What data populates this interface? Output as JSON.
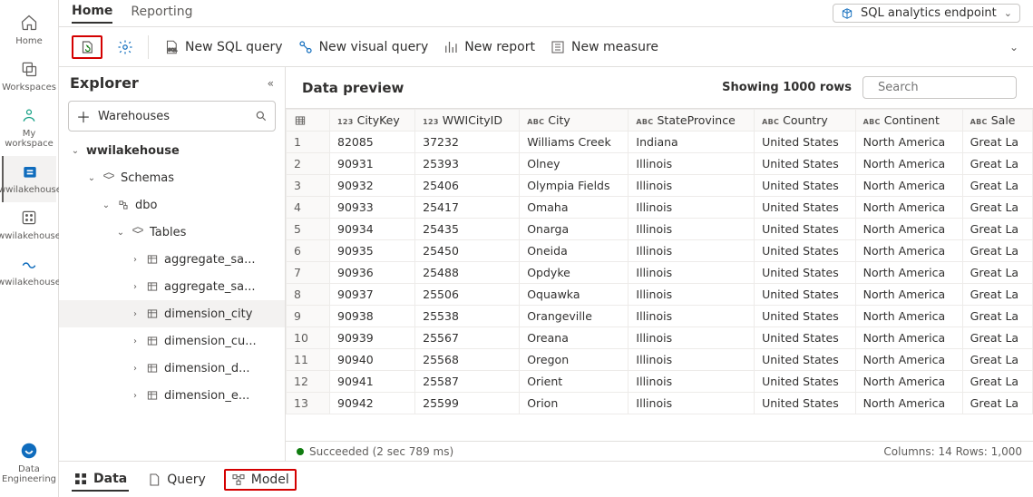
{
  "rail": {
    "home": "Home",
    "workspaces": "Workspaces",
    "my_workspace": "My workspace",
    "item1": "wwilakehouse",
    "item2": "wwilakehouse",
    "item3": "wwilakehouse",
    "data_eng": "Data Engineering"
  },
  "tabs": {
    "home": "Home",
    "reporting": "Reporting"
  },
  "endpoint": {
    "label": "SQL analytics endpoint"
  },
  "toolbar": {
    "new_sql": "New SQL query",
    "new_visual": "New visual query",
    "new_report": "New report",
    "new_measure": "New measure"
  },
  "explorer": {
    "title": "Explorer",
    "warehouses": "Warehouses",
    "lakehouse": "wwilakehouse",
    "schemas": "Schemas",
    "dbo": "dbo",
    "tables": "Tables",
    "items": [
      "aggregate_sa...",
      "aggregate_sa...",
      "dimension_city",
      "dimension_cu...",
      "dimension_d...",
      "dimension_e..."
    ]
  },
  "preview": {
    "title": "Data preview",
    "showing": "Showing 1000 rows",
    "search_placeholder": "Search",
    "columns": [
      {
        "badge": "123",
        "name": "CityKey"
      },
      {
        "badge": "123",
        "name": "WWICityID"
      },
      {
        "badge": "ABC",
        "name": "City"
      },
      {
        "badge": "ABC",
        "name": "StateProvince"
      },
      {
        "badge": "ABC",
        "name": "Country"
      },
      {
        "badge": "ABC",
        "name": "Continent"
      },
      {
        "badge": "ABC",
        "name": "Sale"
      }
    ],
    "rows": [
      [
        "82085",
        "37232",
        "Williams Creek",
        "Indiana",
        "United States",
        "North America",
        "Great La"
      ],
      [
        "90931",
        "25393",
        "Olney",
        "Illinois",
        "United States",
        "North America",
        "Great La"
      ],
      [
        "90932",
        "25406",
        "Olympia Fields",
        "Illinois",
        "United States",
        "North America",
        "Great La"
      ],
      [
        "90933",
        "25417",
        "Omaha",
        "Illinois",
        "United States",
        "North America",
        "Great La"
      ],
      [
        "90934",
        "25435",
        "Onarga",
        "Illinois",
        "United States",
        "North America",
        "Great La"
      ],
      [
        "90935",
        "25450",
        "Oneida",
        "Illinois",
        "United States",
        "North America",
        "Great La"
      ],
      [
        "90936",
        "25488",
        "Opdyke",
        "Illinois",
        "United States",
        "North America",
        "Great La"
      ],
      [
        "90937",
        "25506",
        "Oquawka",
        "Illinois",
        "United States",
        "North America",
        "Great La"
      ],
      [
        "90938",
        "25538",
        "Orangeville",
        "Illinois",
        "United States",
        "North America",
        "Great La"
      ],
      [
        "90939",
        "25567",
        "Oreana",
        "Illinois",
        "United States",
        "North America",
        "Great La"
      ],
      [
        "90940",
        "25568",
        "Oregon",
        "Illinois",
        "United States",
        "North America",
        "Great La"
      ],
      [
        "90941",
        "25587",
        "Orient",
        "Illinois",
        "United States",
        "North America",
        "Great La"
      ],
      [
        "90942",
        "25599",
        "Orion",
        "Illinois",
        "United States",
        "North America",
        "Great La"
      ]
    ]
  },
  "status": {
    "msg": "Succeeded (2 sec 789 ms)",
    "cols": "Columns:  14  Rows:  1,000"
  },
  "bottom": {
    "data": "Data",
    "query": "Query",
    "model": "Model"
  }
}
